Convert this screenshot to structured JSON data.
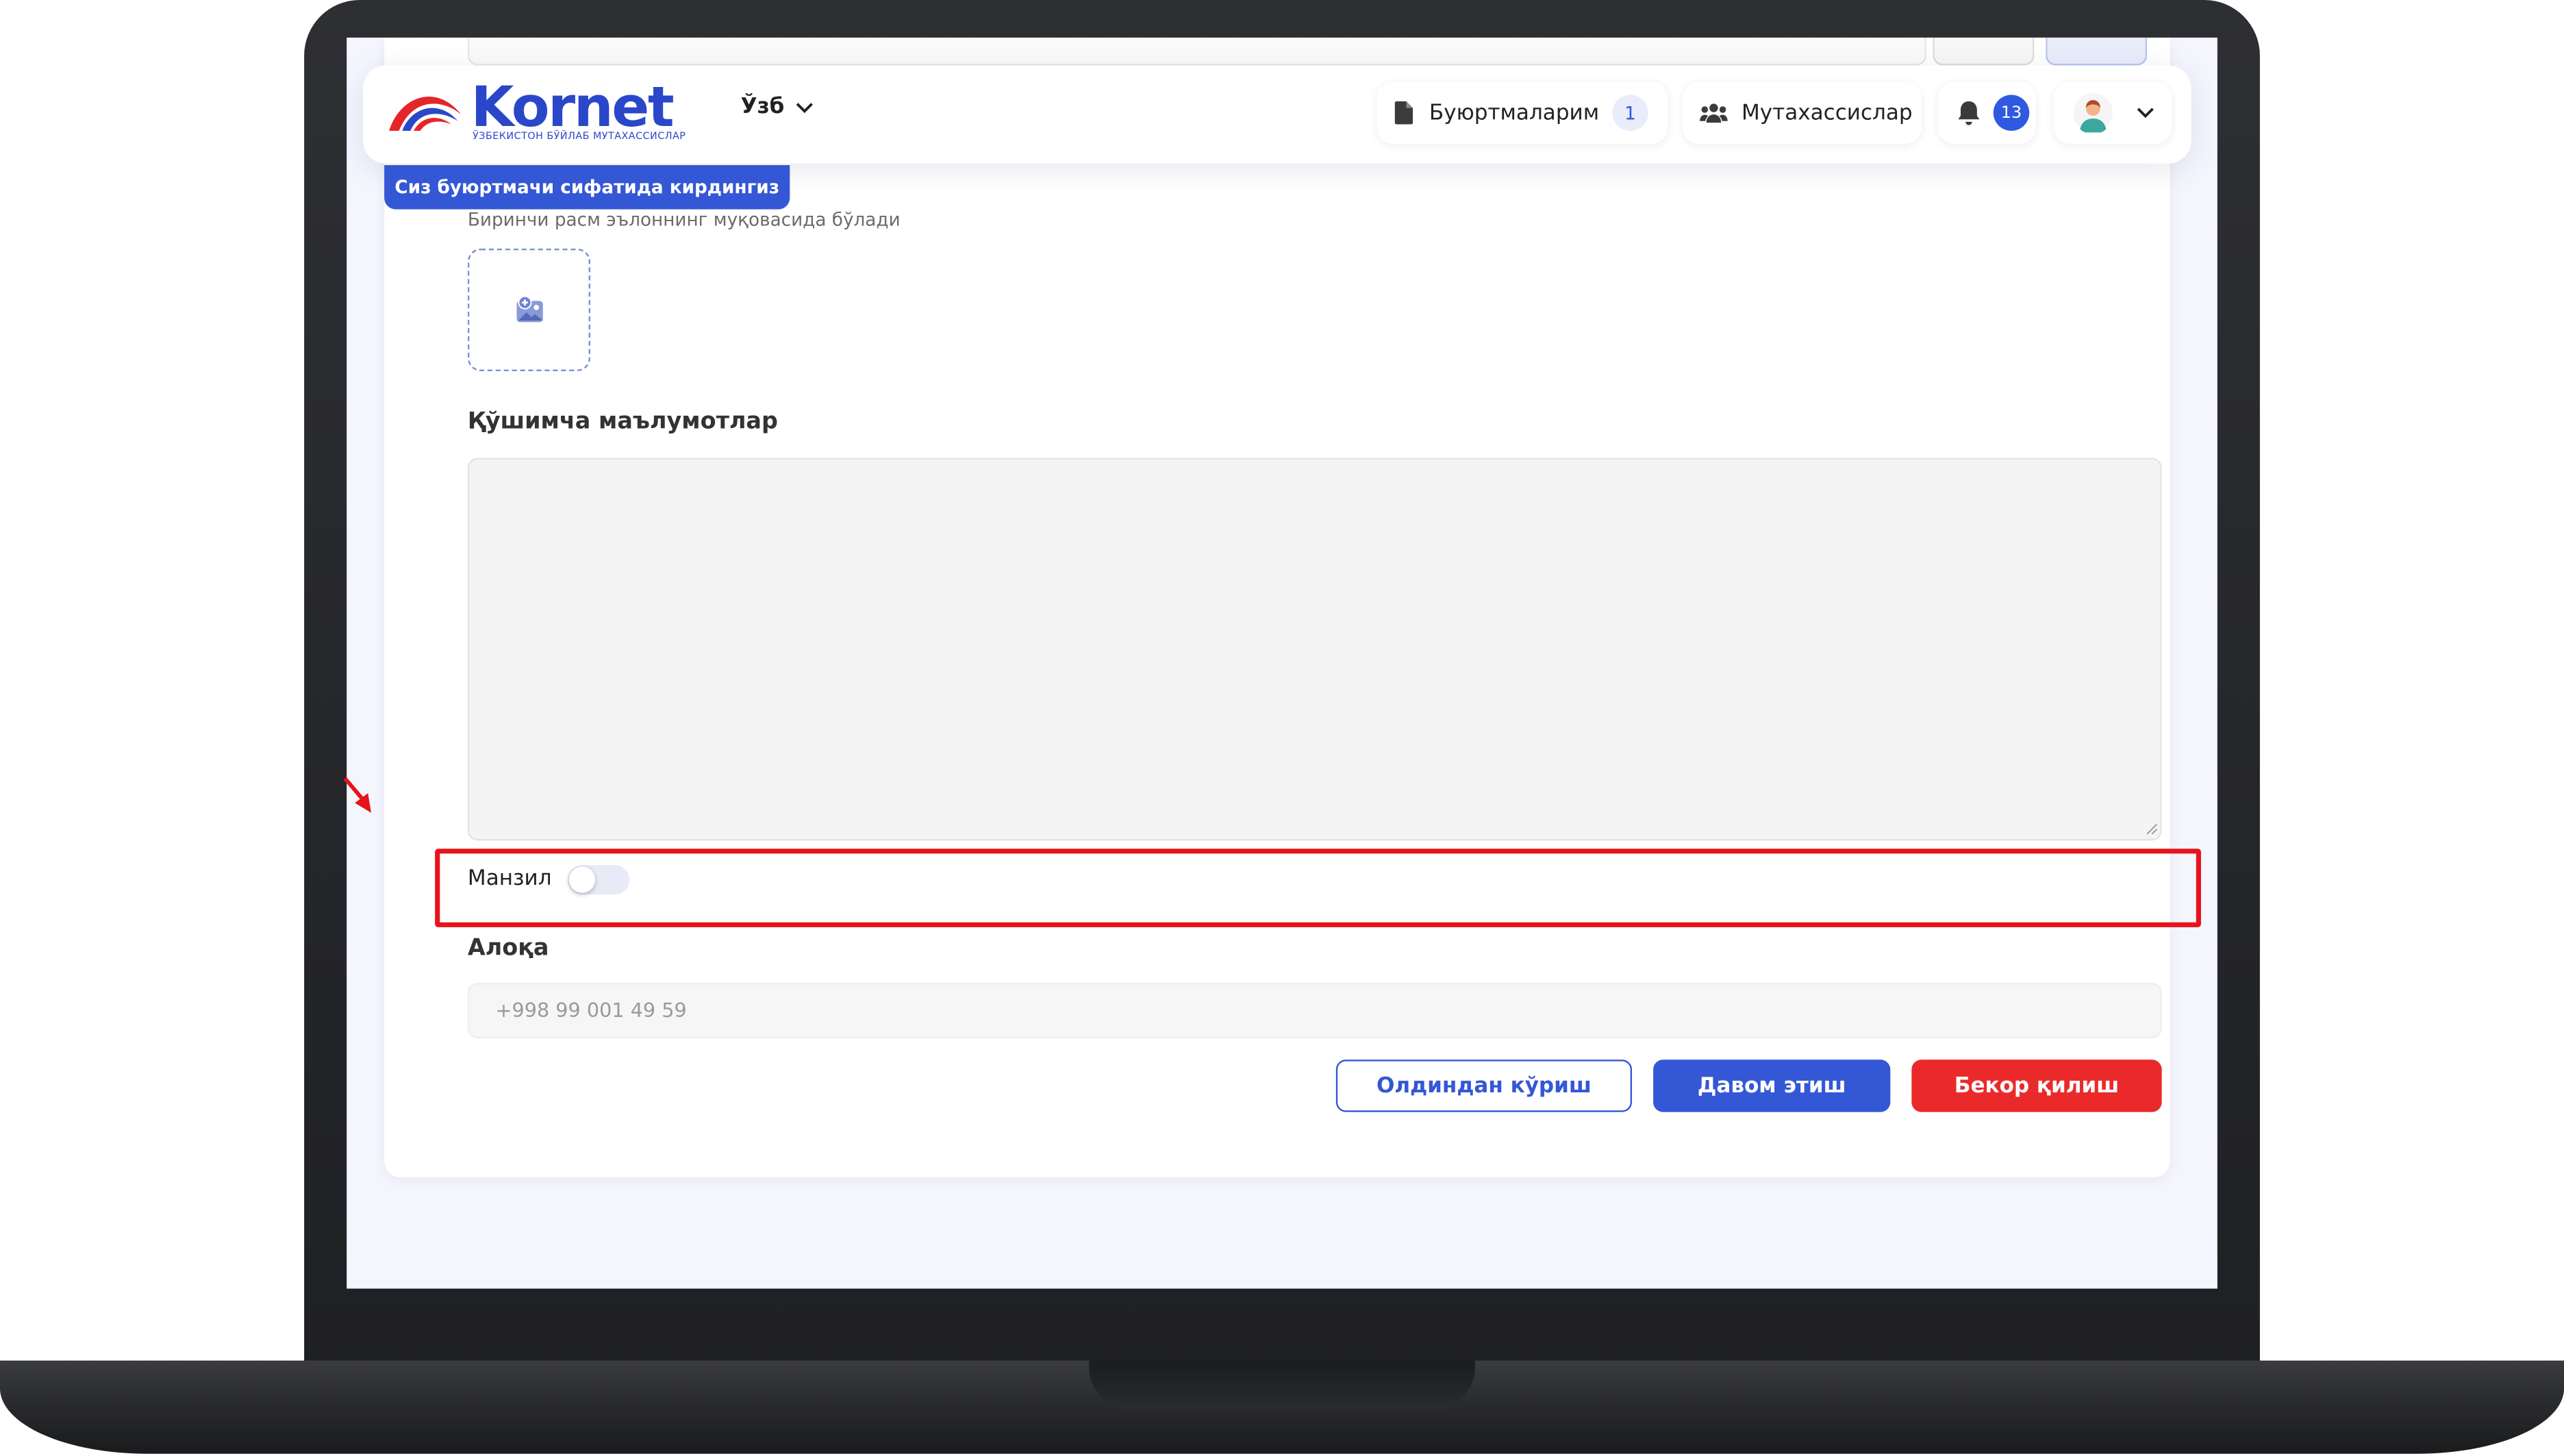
{
  "brand": {
    "name": "Kornet",
    "tagline": "ЎЗБЕКИСТОН БЎЙЛАБ МУТАХАССИСЛАР"
  },
  "header": {
    "language": "Ўзб",
    "orders_label": "Буюртмаларим",
    "orders_count": "1",
    "specialists_label": "Мутахассислар",
    "notifications_count": "13"
  },
  "role_banner": "Сиз буюртмачи сифатида кирдингиз",
  "form": {
    "image_hint": "Биринчи расм эълоннинг муқовасида бўлади",
    "extra_info_label": "Қўшимча маълумотлар",
    "address_label": "Манзил",
    "address_enabled": false,
    "contact_label": "Алоқа",
    "phone_placeholder": "+998 99 001 49 59"
  },
  "buttons": {
    "preview": "Олдиндан кўриш",
    "continue": "Давом этиш",
    "cancel": "Бекор қилиш"
  },
  "colors": {
    "primary": "#3457d5",
    "danger": "#ea2a2a",
    "highlight": "#e6131b"
  }
}
